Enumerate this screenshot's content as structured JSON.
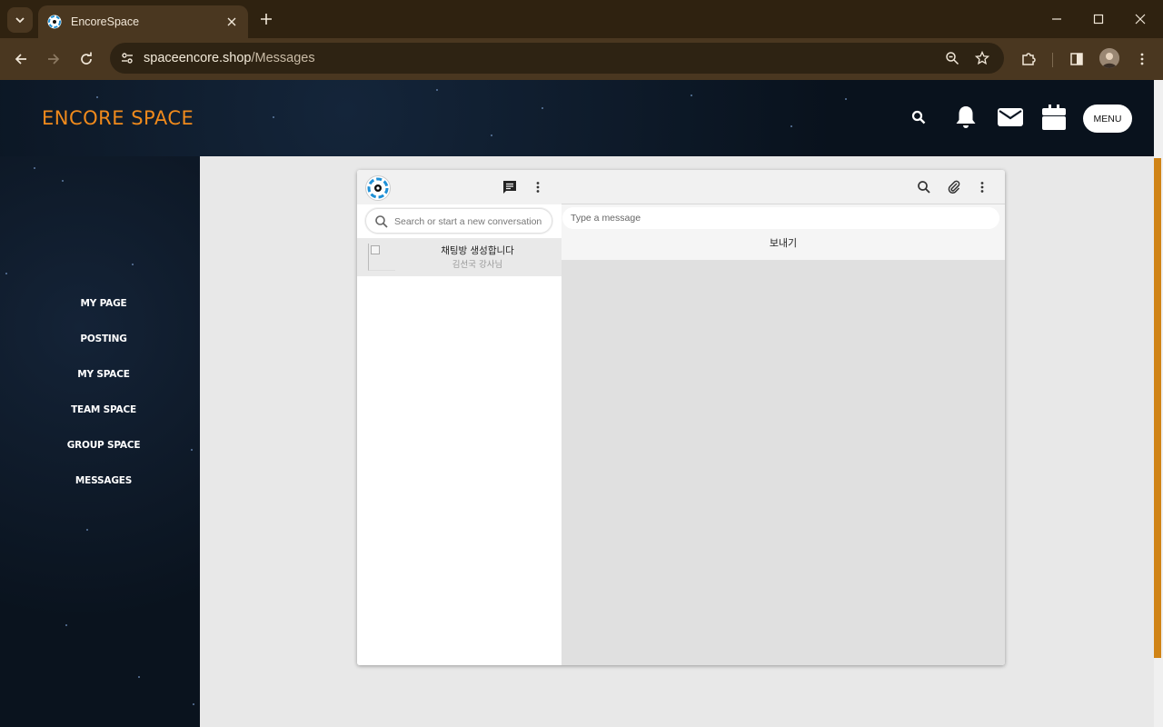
{
  "browser": {
    "tab_title": "EncoreSpace",
    "url_domain": "spaceencore.shop",
    "url_path": "/Messages"
  },
  "header": {
    "logo": "ENCORE SPACE",
    "menu_label": "MENU",
    "accent_color": "#f08a1c"
  },
  "sidebar": {
    "items": [
      {
        "label": "MY PAGE"
      },
      {
        "label": "POSTING"
      },
      {
        "label": "MY SPACE"
      },
      {
        "label": "TEAM SPACE"
      },
      {
        "label": "GROUP SPACE"
      },
      {
        "label": "MESSAGES"
      }
    ]
  },
  "chat": {
    "search_placeholder": "Search or start a new conversation",
    "conversations": [
      {
        "title": "채팅방 생성합니다",
        "subtitle": "김선국 강사님"
      }
    ],
    "message_placeholder": "Type a message",
    "send_label": "보내기"
  }
}
